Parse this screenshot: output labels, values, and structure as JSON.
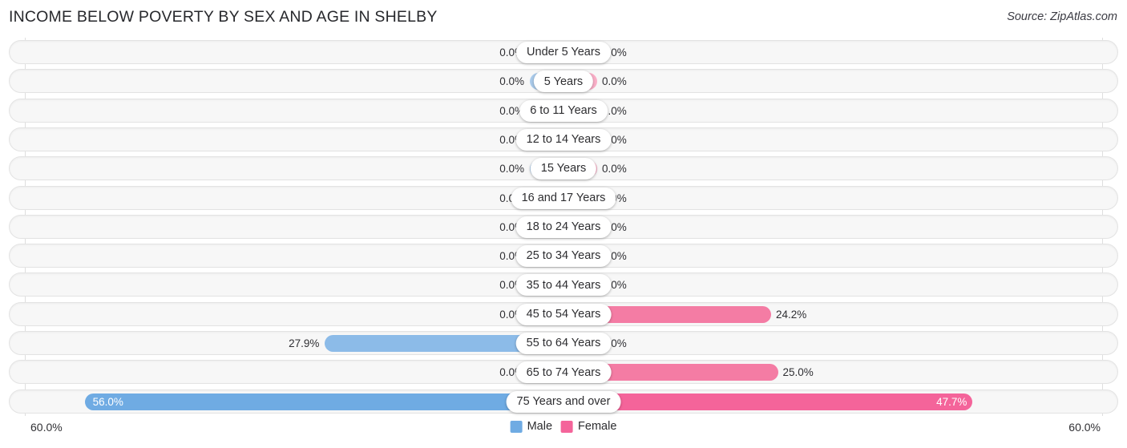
{
  "header": {
    "title": "INCOME BELOW POVERTY BY SEX AND AGE IN SHELBY",
    "source": "Source: ZipAtlas.com"
  },
  "legend": {
    "male_label": "Male",
    "female_label": "Female",
    "male_color": "#6fabe3",
    "female_color": "#f4649a"
  },
  "axis": {
    "left_label": "60.0%",
    "right_label": "60.0%",
    "max": 60.0
  },
  "colors": {
    "male_light": "#aacbeb",
    "male_mid": "#8cbbe8",
    "male_dark": "#6fabe3",
    "female_light": "#f9aec7",
    "female_mid": "#f47ca4",
    "female_dark": "#f4649a",
    "row_bg": "#f7f7f7",
    "row_border": "#e3e3e3"
  },
  "chart_data": {
    "type": "bar",
    "orientation": "horizontal",
    "layout": "diverging-pyramid",
    "title": "INCOME BELOW POVERTY BY SEX AND AGE IN SHELBY",
    "xlabel": "",
    "ylabel": "",
    "xlim": [
      0,
      60.0
    ],
    "grid": false,
    "legend_position": "bottom-center",
    "categories": [
      "Under 5 Years",
      "5 Years",
      "6 to 11 Years",
      "12 to 14 Years",
      "15 Years",
      "16 and 17 Years",
      "18 to 24 Years",
      "25 to 34 Years",
      "35 to 44 Years",
      "45 to 54 Years",
      "55 to 64 Years",
      "65 to 74 Years",
      "75 Years and over"
    ],
    "series": [
      {
        "name": "Male",
        "values": [
          0.0,
          0.0,
          0.0,
          0.0,
          0.0,
          0.0,
          0.0,
          0.0,
          0.0,
          0.0,
          27.9,
          0.0,
          56.0
        ],
        "labels": [
          "0.0%",
          "0.0%",
          "0.0%",
          "0.0%",
          "0.0%",
          "0.0%",
          "0.0%",
          "0.0%",
          "0.0%",
          "0.0%",
          "27.9%",
          "0.0%",
          "56.0%"
        ]
      },
      {
        "name": "Female",
        "values": [
          0.0,
          0.0,
          0.0,
          0.0,
          0.0,
          0.0,
          0.0,
          0.0,
          0.0,
          24.2,
          0.0,
          25.0,
          47.7
        ],
        "labels": [
          "0.0%",
          "0.0%",
          "0.0%",
          "0.0%",
          "0.0%",
          "0.0%",
          "0.0%",
          "0.0%",
          "0.0%",
          "24.2%",
          "0.0%",
          "25.0%",
          "47.7%"
        ]
      }
    ]
  },
  "rows": [
    {
      "label": "Under 5 Years",
      "male": "0.0%",
      "female": "0.0%"
    },
    {
      "label": "5 Years",
      "male": "0.0%",
      "female": "0.0%"
    },
    {
      "label": "6 to 11 Years",
      "male": "0.0%",
      "female": "0.0%"
    },
    {
      "label": "12 to 14 Years",
      "male": "0.0%",
      "female": "0.0%"
    },
    {
      "label": "15 Years",
      "male": "0.0%",
      "female": "0.0%"
    },
    {
      "label": "16 and 17 Years",
      "male": "0.0%",
      "female": "0.0%"
    },
    {
      "label": "18 to 24 Years",
      "male": "0.0%",
      "female": "0.0%"
    },
    {
      "label": "25 to 34 Years",
      "male": "0.0%",
      "female": "0.0%"
    },
    {
      "label": "35 to 44 Years",
      "male": "0.0%",
      "female": "0.0%"
    },
    {
      "label": "45 to 54 Years",
      "male": "0.0%",
      "female": "24.2%"
    },
    {
      "label": "55 to 64 Years",
      "male": "27.9%",
      "female": "0.0%"
    },
    {
      "label": "65 to 74 Years",
      "male": "0.0%",
      "female": "25.0%"
    },
    {
      "label": "75 Years and over",
      "male": "56.0%",
      "female": "47.7%"
    }
  ]
}
